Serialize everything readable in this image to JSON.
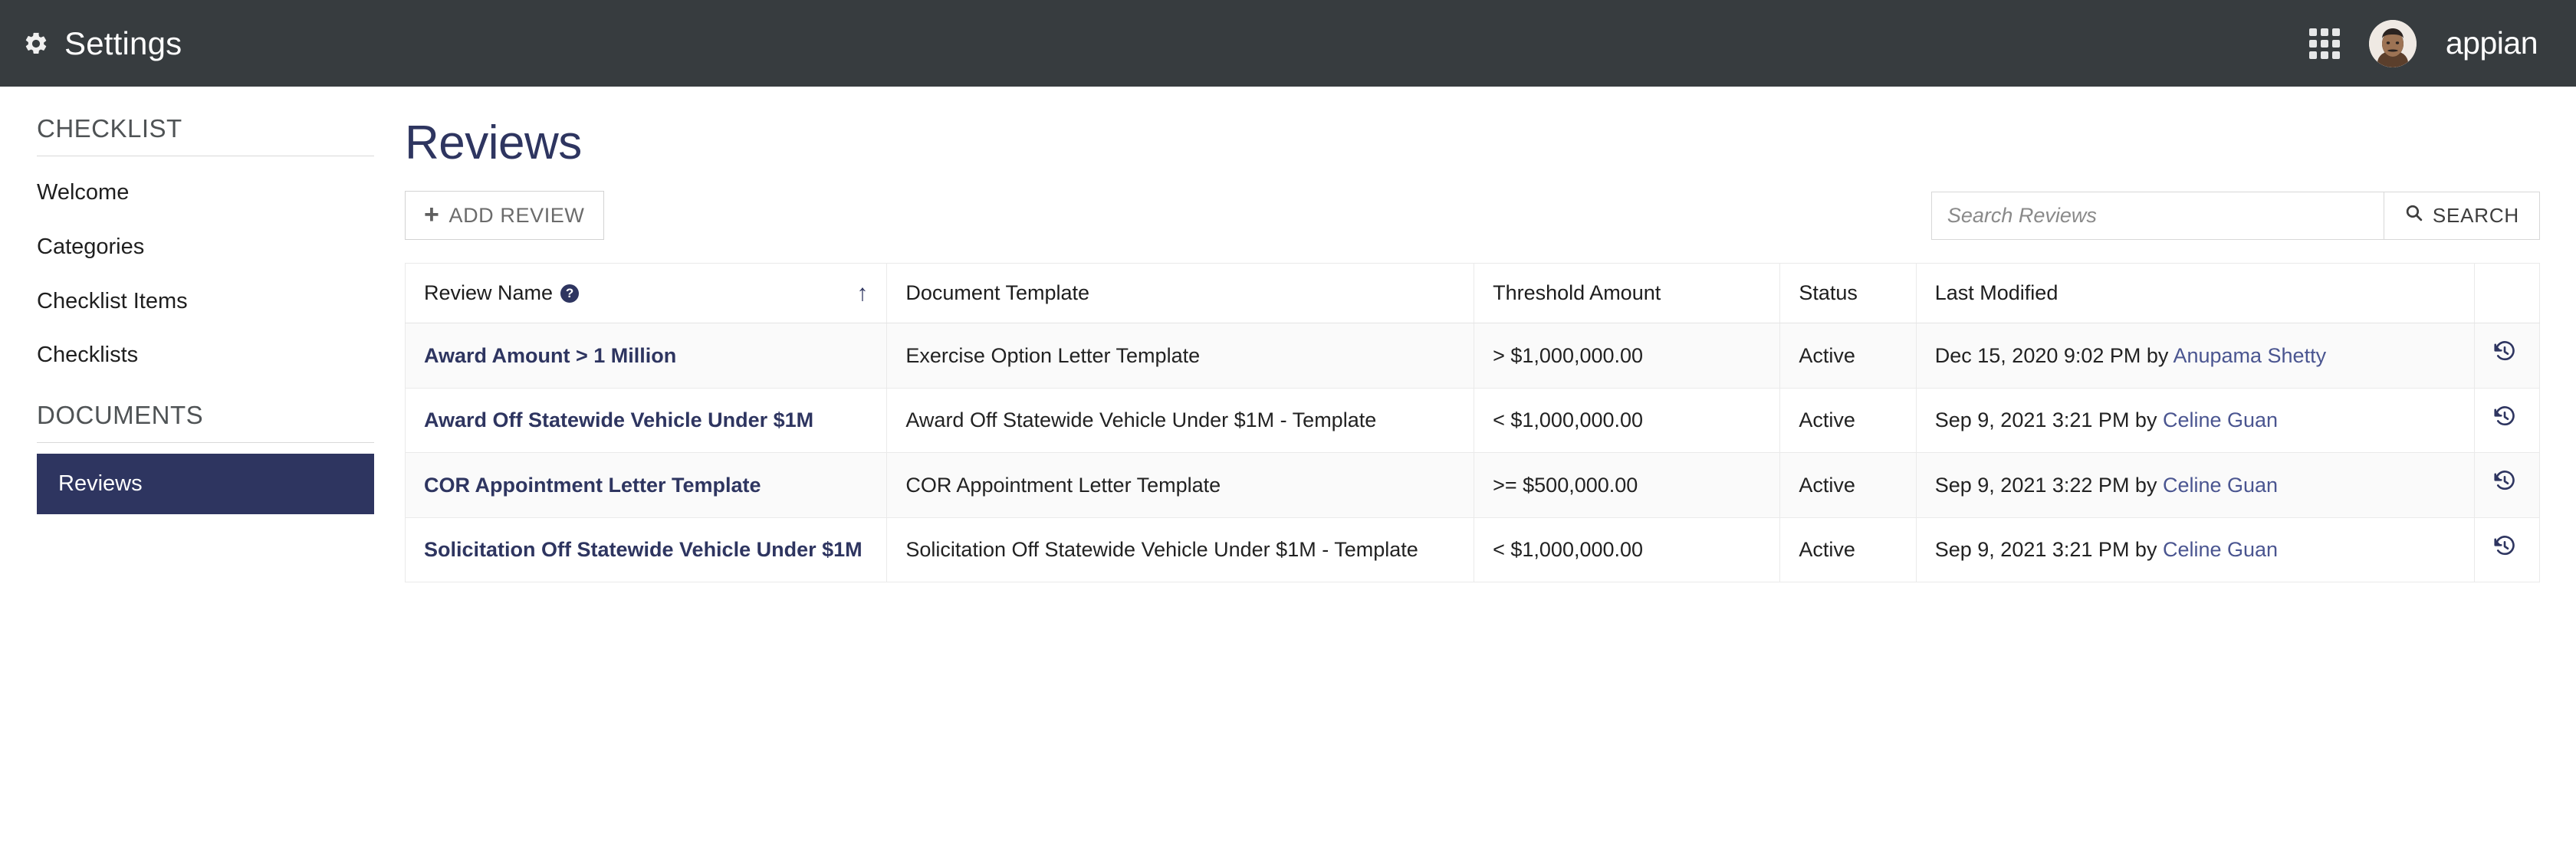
{
  "topbar": {
    "gear_icon": "gear-icon",
    "title": "Settings",
    "apps_icon": "app-grid-icon",
    "avatar_icon": "user-avatar",
    "brand": "appian"
  },
  "sidebar": {
    "groups": [
      {
        "title": "CHECKLIST",
        "items": [
          {
            "label": "Welcome",
            "active": false
          },
          {
            "label": "Categories",
            "active": false
          },
          {
            "label": "Checklist Items",
            "active": false
          },
          {
            "label": "Checklists",
            "active": false
          }
        ]
      },
      {
        "title": "DOCUMENTS",
        "items": [
          {
            "label": "Reviews",
            "active": true
          }
        ]
      }
    ]
  },
  "main": {
    "page_title": "Reviews",
    "add_button": {
      "plus": "+",
      "label": "ADD REVIEW"
    },
    "search": {
      "placeholder": "Search Reviews",
      "value": "",
      "button_label": "SEARCH",
      "button_icon": "search-icon"
    },
    "table": {
      "columns": [
        {
          "label": "Review Name",
          "help_icon": "help-circle-icon",
          "sort": "ascending",
          "sort_glyph": "↑"
        },
        {
          "label": "Document Template"
        },
        {
          "label": "Threshold Amount"
        },
        {
          "label": "Status"
        },
        {
          "label": "Last Modified"
        },
        {
          "label": ""
        }
      ],
      "rows": [
        {
          "name": "Award Amount > 1 Million",
          "document_template": "Exercise Option Letter Template",
          "threshold": "> $1,000,000.00",
          "status": "Active",
          "modified_prefix": "Dec 15, 2020 9:02 PM by ",
          "modified_user": "Anupama Shetty",
          "action_icon": "history-icon"
        },
        {
          "name": "Award Off Statewide Vehicle Under $1M",
          "document_template": "Award Off Statewide Vehicle Under $1M - Template",
          "threshold": "< $1,000,000.00",
          "status": "Active",
          "modified_prefix": "Sep 9, 2021 3:21 PM by ",
          "modified_user": "Celine Guan",
          "action_icon": "history-icon"
        },
        {
          "name": "COR Appointment Letter Template",
          "document_template": "COR Appointment Letter Template",
          "threshold": ">= $500,000.00",
          "status": "Active",
          "modified_prefix": "Sep 9, 2021 3:22 PM by ",
          "modified_user": "Celine Guan",
          "action_icon": "history-icon"
        },
        {
          "name": "Solicitation Off Statewide Vehicle Under $1M",
          "document_template": "Solicitation Off Statewide Vehicle Under $1M - Template",
          "threshold": "< $1,000,000.00",
          "status": "Active",
          "modified_prefix": "Sep 9, 2021 3:21 PM by ",
          "modified_user": "Celine Guan",
          "action_icon": "history-icon"
        }
      ]
    }
  },
  "colors": {
    "topbar_bg": "#373C3F",
    "accent_navy": "#2E3560",
    "link_navy": "#4a5590",
    "row_stripe": "#FAFAFA",
    "border": "#eaeaea"
  }
}
